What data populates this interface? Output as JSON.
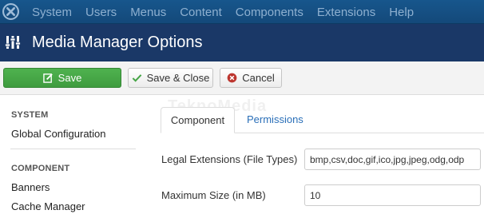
{
  "topnav": {
    "logo_icon": "joomla-logo-icon",
    "items": [
      "System",
      "Users",
      "Menus",
      "Content",
      "Components",
      "Extensions",
      "Help"
    ]
  },
  "header": {
    "icon": "options-sliders-icon",
    "title": "Media Manager Options"
  },
  "toolbar": {
    "save_label": "Save",
    "save_close_label": "Save & Close",
    "cancel_label": "Cancel"
  },
  "sidebar": {
    "system_heading": "SYSTEM",
    "global_config": "Global Configuration",
    "component_heading": "COMPONENT",
    "items": [
      "Banners",
      "Cache Manager"
    ]
  },
  "tabs": {
    "active": "Component",
    "other": "Permissions"
  },
  "form": {
    "legal_extensions_label": "Legal Extensions (File Types)",
    "legal_extensions_value": "bmp,csv,doc,gif,ico,jpg,jpeg,odg,odp",
    "max_size_label": "Maximum Size (in MB)",
    "max_size_value": "10"
  },
  "watermark": "TeknoMedia",
  "colors": {
    "topnav": "#17568c",
    "header": "#1a3867",
    "save_green": "#46a546",
    "cancel_red": "#bd362f",
    "link_blue": "#2a6fb8"
  }
}
